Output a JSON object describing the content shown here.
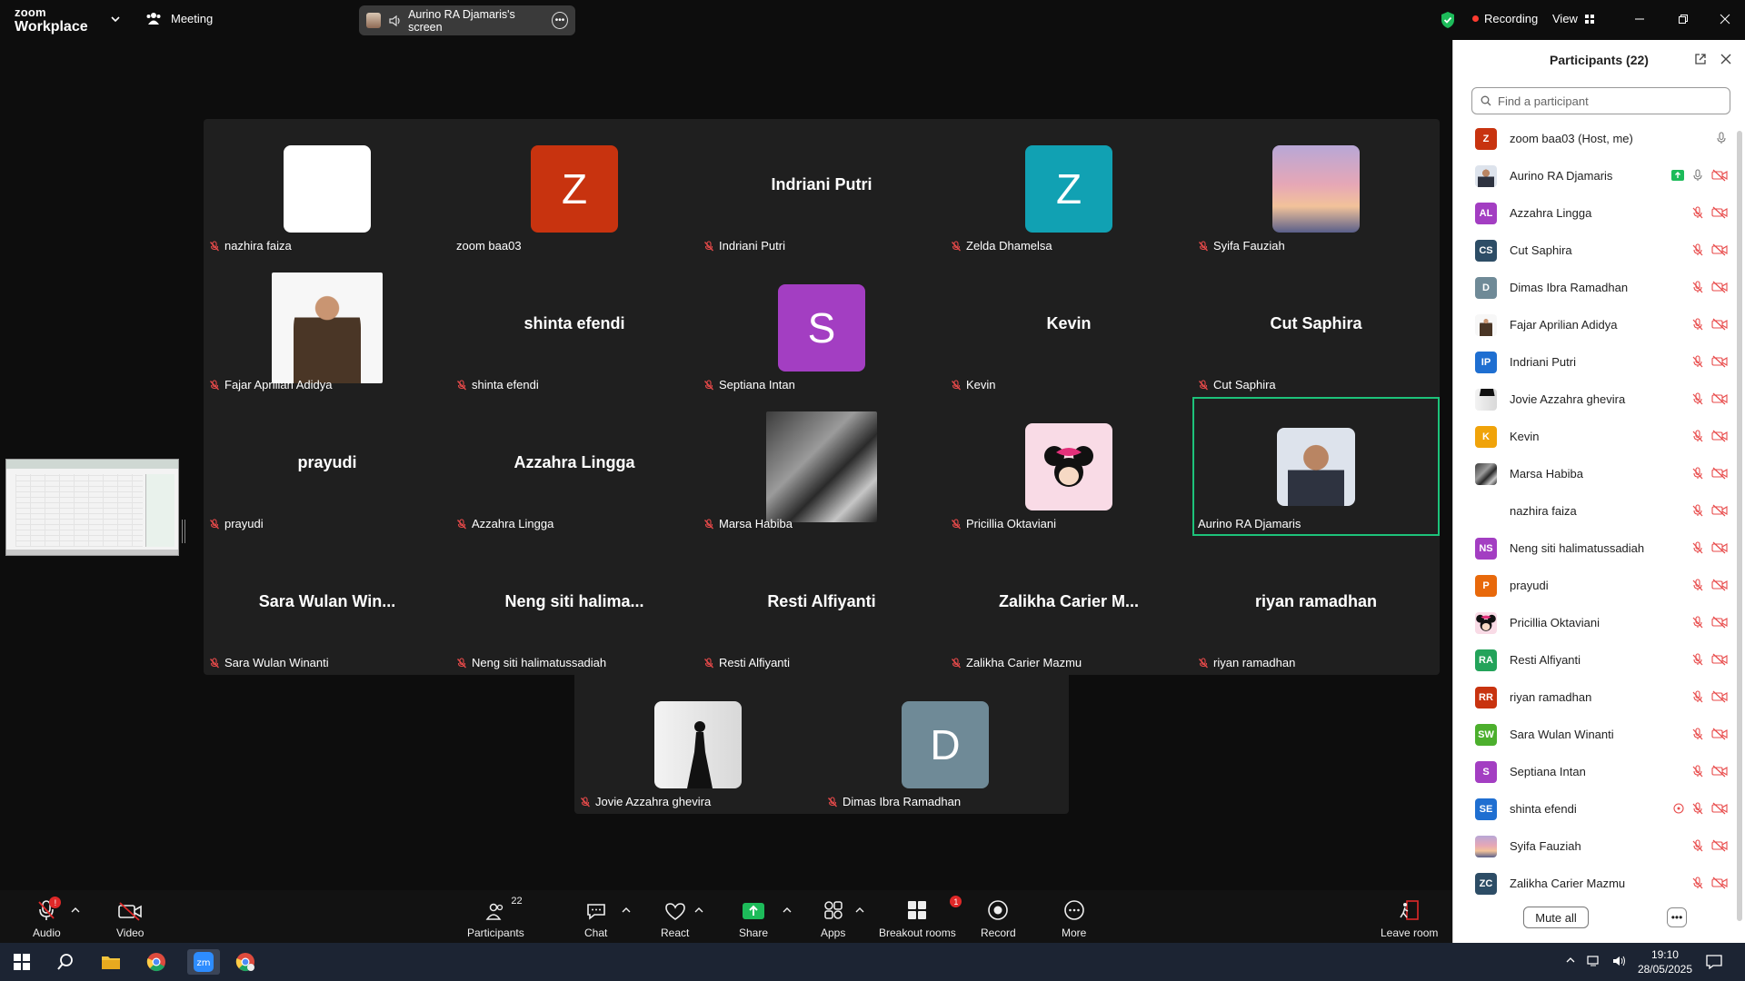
{
  "titlebar": {
    "logo_line1": "zoom",
    "logo_line2": "Workplace",
    "meeting_label": "Meeting",
    "share_label": "Aurino RA Djamaris's screen",
    "recording_label": "Recording",
    "view_label": "View"
  },
  "tiles": [
    {
      "name": "nazhira faiza",
      "style": "white",
      "muted": true
    },
    {
      "name": "zoom baa03",
      "initial": "Z",
      "color": "#c8330f",
      "muted": false
    },
    {
      "name": "Indriani Putri",
      "big": "Indriani Putri",
      "muted": true
    },
    {
      "name": "Zelda Dhamelsa",
      "initial": "Z",
      "color": "#11a1b3",
      "muted": true
    },
    {
      "name": "Syifa Fauziah",
      "style": "sky",
      "muted": true
    },
    {
      "name": "Fajar Aprilian Adidya",
      "style": "man",
      "muted": true
    },
    {
      "name": "shinta efendi",
      "big": "shinta efendi",
      "muted": true
    },
    {
      "name": "Septiana Intan",
      "initial": "S",
      "color": "#a33ec2",
      "muted": true
    },
    {
      "name": "Kevin",
      "big": "Kevin",
      "muted": true
    },
    {
      "name": "Cut Saphira",
      "big": "Cut Saphira",
      "muted": true
    },
    {
      "name": "prayudi",
      "big": "prayudi",
      "muted": true
    },
    {
      "name": "Azzahra Lingga",
      "big": "Azzahra Lingga",
      "muted": true
    },
    {
      "name": "Marsa Habiba",
      "style": "dark",
      "muted": true
    },
    {
      "name": "Pricillia Oktaviani",
      "style": "minnie",
      "muted": true
    },
    {
      "name": "Aurino RA Djamaris",
      "style": "portrait",
      "muted": false,
      "active": true
    },
    {
      "name": "Sara Wulan Winanti",
      "big": "Sara Wulan Win...",
      "muted": true
    },
    {
      "name": "Neng siti halimatussadiah",
      "big": "Neng siti halima...",
      "muted": true
    },
    {
      "name": "Resti Alfiyanti",
      "big": "Resti Alfiyanti",
      "muted": true
    },
    {
      "name": "Zalikha Carier Mazmu",
      "big": "Zalikha Carier M...",
      "muted": true
    },
    {
      "name": "riyan ramadhan",
      "big": "riyan ramadhan",
      "muted": true
    },
    {
      "name": "Jovie Azzahra ghevira",
      "style": "silhouette",
      "muted": true
    },
    {
      "name": "Dimas Ibra Ramadhan",
      "initial": "D",
      "color": "#6f8a97",
      "muted": true
    }
  ],
  "panel": {
    "title": "Participants (22)",
    "search_placeholder": "Find a participant",
    "mute_all": "Mute all",
    "participants": [
      {
        "name": "zoom baa03 (Host, me)",
        "av": "Z",
        "color": "#c8330f",
        "icons": "host"
      },
      {
        "name": "Aurino RA Djamaris",
        "av": "",
        "photo": "portrait",
        "icons": "share"
      },
      {
        "name": "Azzahra Lingga",
        "av": "AL",
        "color": "#a33ec2",
        "icons": "muted"
      },
      {
        "name": "Cut Saphira",
        "av": "CS",
        "color": "#2d4d66",
        "icons": "muted"
      },
      {
        "name": "Dimas Ibra Ramadhan",
        "av": "D",
        "color": "#6f8a97",
        "icons": "muted"
      },
      {
        "name": "Fajar Aprilian Adidya",
        "av": "",
        "photo": "man",
        "icons": "muted"
      },
      {
        "name": "Indriani Putri",
        "av": "IP",
        "color": "#1f6fd1",
        "icons": "muted"
      },
      {
        "name": "Jovie Azzahra ghevira",
        "av": "",
        "photo": "silhouette",
        "icons": "muted"
      },
      {
        "name": "Kevin",
        "av": "K",
        "color": "#f0a30a",
        "icons": "muted"
      },
      {
        "name": "Marsa Habiba",
        "av": "",
        "photo": "dark",
        "icons": "muted"
      },
      {
        "name": "nazhira faiza",
        "av": "",
        "photo": "blank",
        "icons": "muted"
      },
      {
        "name": "Neng siti halimatussadiah",
        "av": "NS",
        "color": "#a33ec2",
        "icons": "muted"
      },
      {
        "name": "prayudi",
        "av": "P",
        "color": "#e8690b",
        "icons": "muted"
      },
      {
        "name": "Pricillia Oktaviani",
        "av": "",
        "photo": "minnie",
        "icons": "muted"
      },
      {
        "name": "Resti Alfiyanti",
        "av": "RA",
        "color": "#23a35a",
        "icons": "muted"
      },
      {
        "name": "riyan ramadhan",
        "av": "RR",
        "color": "#c8330f",
        "icons": "muted"
      },
      {
        "name": "Sara Wulan Winanti",
        "av": "SW",
        "color": "#4caf2d",
        "icons": "muted"
      },
      {
        "name": "Septiana Intan",
        "av": "S",
        "color": "#a33ec2",
        "icons": "muted"
      },
      {
        "name": "shinta efendi",
        "av": "SE",
        "color": "#1f6fd1",
        "icons": "muted-extra"
      },
      {
        "name": "Syifa Fauziah",
        "av": "",
        "photo": "sky",
        "icons": "muted"
      },
      {
        "name": "Zalikha Carier Mazmu",
        "av": "ZC",
        "color": "#2d4d66",
        "icons": "muted"
      }
    ]
  },
  "toolbar": {
    "audio": "Audio",
    "video": "Video",
    "participants": "Participants",
    "participants_count": "22",
    "chat": "Chat",
    "react": "React",
    "share": "Share",
    "apps": "Apps",
    "breakout": "Breakout rooms",
    "breakout_badge": "1",
    "record": "Record",
    "more": "More",
    "leave": "Leave room"
  },
  "taskbar": {
    "time": "19:10",
    "date": "28/05/2025"
  }
}
